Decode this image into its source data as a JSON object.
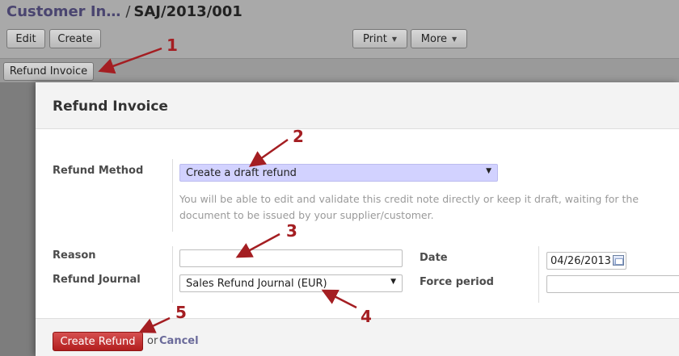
{
  "breadcrumb": {
    "parent": "Customer In…",
    "separator": "/",
    "current": "SAJ/2013/001"
  },
  "toolbar": {
    "edit": "Edit",
    "create": "Create",
    "print": "Print",
    "more": "More"
  },
  "refund_invoice_button": "Refund Invoice",
  "dialog": {
    "title": "Refund Invoice",
    "refund_method_label": "Refund Method",
    "refund_method_value": "Create a draft refund",
    "refund_method_help": "You will be able to edit and validate this credit note directly or keep it draft, waiting for the document to be issued by your supplier/customer.",
    "reason_label": "Reason",
    "reason_value": "",
    "refund_journal_label": "Refund Journal",
    "refund_journal_value": "Sales Refund Journal (EUR)",
    "date_label": "Date",
    "date_value": "04/26/2013",
    "force_period_label": "Force period",
    "force_period_value": "",
    "create_refund_button": "Create Refund",
    "or_text": "or",
    "cancel_link": "Cancel"
  },
  "annotations": [
    "1",
    "2",
    "3",
    "4",
    "5"
  ],
  "colors": {
    "required_field": "#d2d2ff",
    "primary_button": "#c03030",
    "annotation": "#a41e22"
  },
  "icons": {
    "calendar": "calendar-icon",
    "dropdown": "chevron-down-icon"
  }
}
